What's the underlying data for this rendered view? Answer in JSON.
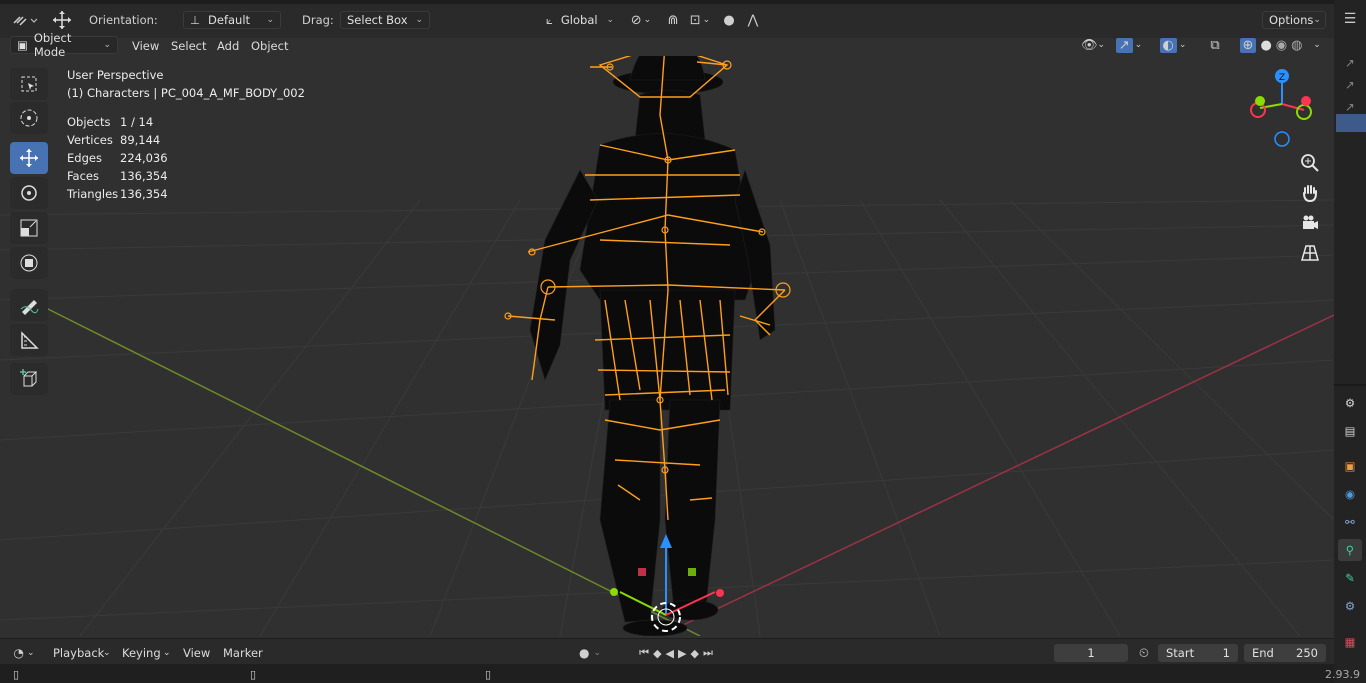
{
  "header": {
    "orientation_label": "Orientation:",
    "orientation_value": "Default",
    "drag_label": "Drag:",
    "drag_value": "Select Box",
    "transform_orientation": "Global",
    "options_label": "Options"
  },
  "viewport_header": {
    "mode": "Object Mode",
    "menus": [
      "View",
      "Select",
      "Add",
      "Object"
    ]
  },
  "overlay": {
    "perspective": "User Perspective",
    "collection_object": "(1) Characters | PC_004_A_MF_BODY_002",
    "stats": [
      {
        "label": "Objects",
        "value": "1 / 14"
      },
      {
        "label": "Vertices",
        "value": "89,144"
      },
      {
        "label": "Edges",
        "value": "224,036"
      },
      {
        "label": "Faces",
        "value": "136,354"
      },
      {
        "label": "Triangles",
        "value": "136,354"
      }
    ]
  },
  "gizmo": {
    "z_label": "Z",
    "x_color": "#ff3352",
    "y_color": "#8bdc00",
    "z_color": "#2890ff"
  },
  "timeline": {
    "menus": [
      "Playback",
      "Keying",
      "View",
      "Marker"
    ],
    "current_frame": "1",
    "start_label": "Start",
    "start_value": "1",
    "end_label": "End",
    "end_value": "250"
  },
  "status": {
    "version": "2.93.9"
  },
  "colors": {
    "armature": "#ff9f1a",
    "active_tool": "#4772b3",
    "mesh": "#0b0b0b"
  }
}
